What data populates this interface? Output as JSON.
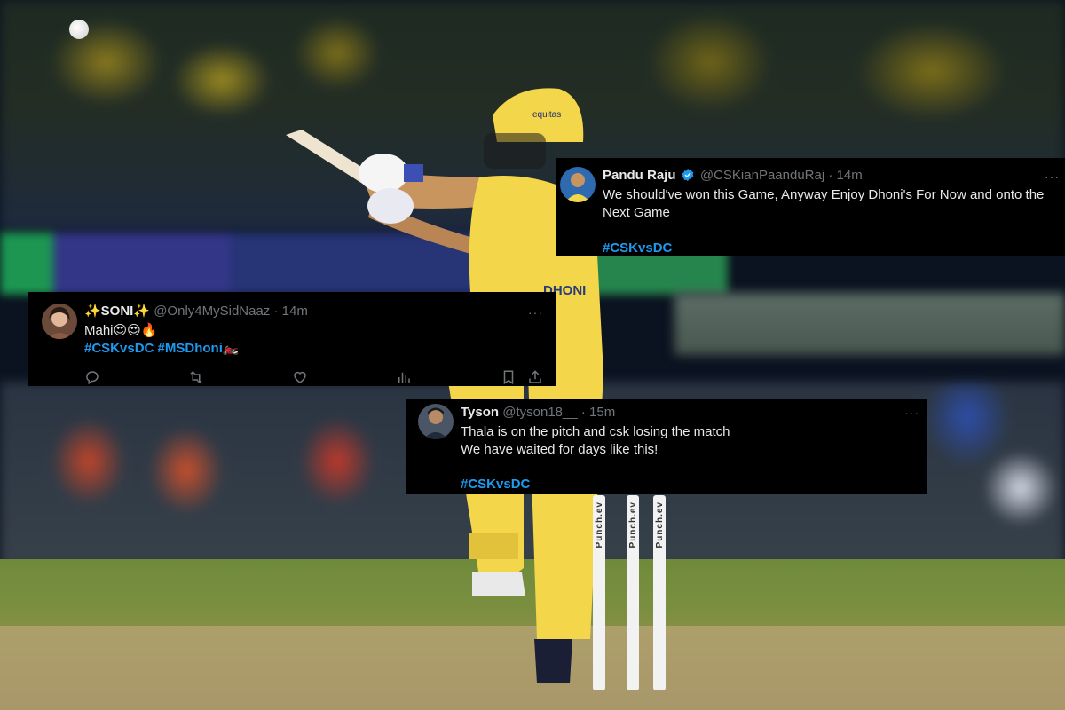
{
  "tweets": [
    {
      "name": "Pandu Raju",
      "verified": true,
      "handle": "@CSKianPaanduRaj",
      "time": "14m",
      "text": "We should've won this Game, Anyway Enjoy Dhoni's For Now and onto the Next Game",
      "hashtags": "#CSKvsDC",
      "more": "···"
    },
    {
      "name": "✨SONI✨",
      "verified": false,
      "handle": "@Only4MySidNaaz",
      "time": "14m",
      "text": "Mahi😍😍🔥",
      "hashtags": "#CSKvsDC #MSDhoni🏍️",
      "more": "···"
    },
    {
      "name": "Tyson",
      "verified": false,
      "handle": "@tyson18__",
      "time": "15m",
      "text": "Thala is on the pitch and csk losing the match\nWe have waited for days like this!",
      "hashtags": "#CSKvsDC",
      "more": "···"
    }
  ],
  "stumps_brand": "Punch.ev",
  "helmet_brand": "equitas",
  "jersey_name": "DHONI",
  "colors": {
    "hashtag": "#1d9bf0",
    "card_bg": "#000000",
    "text": "#e7e9ea",
    "muted": "#71767b",
    "csk_yellow": "#f3d64a"
  }
}
